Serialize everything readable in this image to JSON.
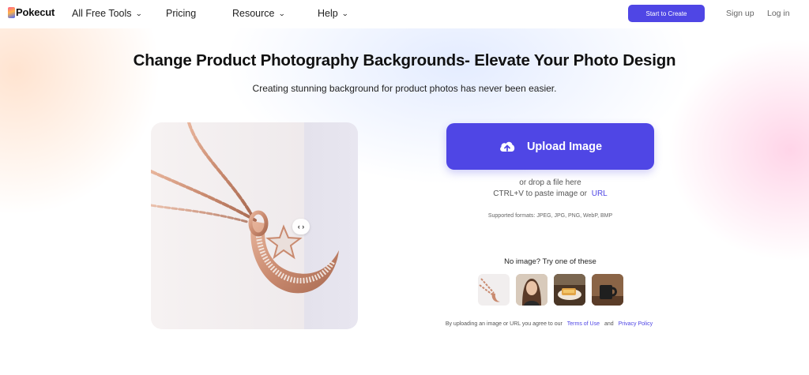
{
  "nav": {
    "logo": "Pokecut",
    "items": [
      {
        "label": "All Free Tools",
        "dropdown": true
      },
      {
        "label": "Pricing",
        "dropdown": false
      },
      {
        "label": "Resource",
        "dropdown": true
      },
      {
        "label": "Help",
        "dropdown": true
      }
    ],
    "cta": "Start to Create",
    "signup": "Sign up",
    "login": "Log in"
  },
  "hero": {
    "title": "Change Product Photography Backgrounds- Elevate Your Photo Design",
    "subtitle": "Creating stunning background for product photos has never been easier."
  },
  "preview": {
    "slider_glyph": "‹ ›"
  },
  "upload": {
    "button_label": "Upload Image",
    "drop_text": "or drop a file here",
    "paste_text": "CTRL+V to paste image or",
    "url_label": "URL",
    "formats": "Supported formats: JPEG, JPG, PNG, WebP, BMP"
  },
  "samples": {
    "prompt": "No image? Try one of these",
    "items": [
      "sample-necklace",
      "sample-portrait",
      "sample-bread",
      "sample-mug"
    ]
  },
  "legal": {
    "prefix": "By uploading an image or URL you agree to our",
    "terms": "Terms of Use",
    "and": "and",
    "privacy": "Privacy Policy"
  },
  "colors": {
    "accent": "#4f46e5",
    "rose_gold": "#c98a6f"
  }
}
